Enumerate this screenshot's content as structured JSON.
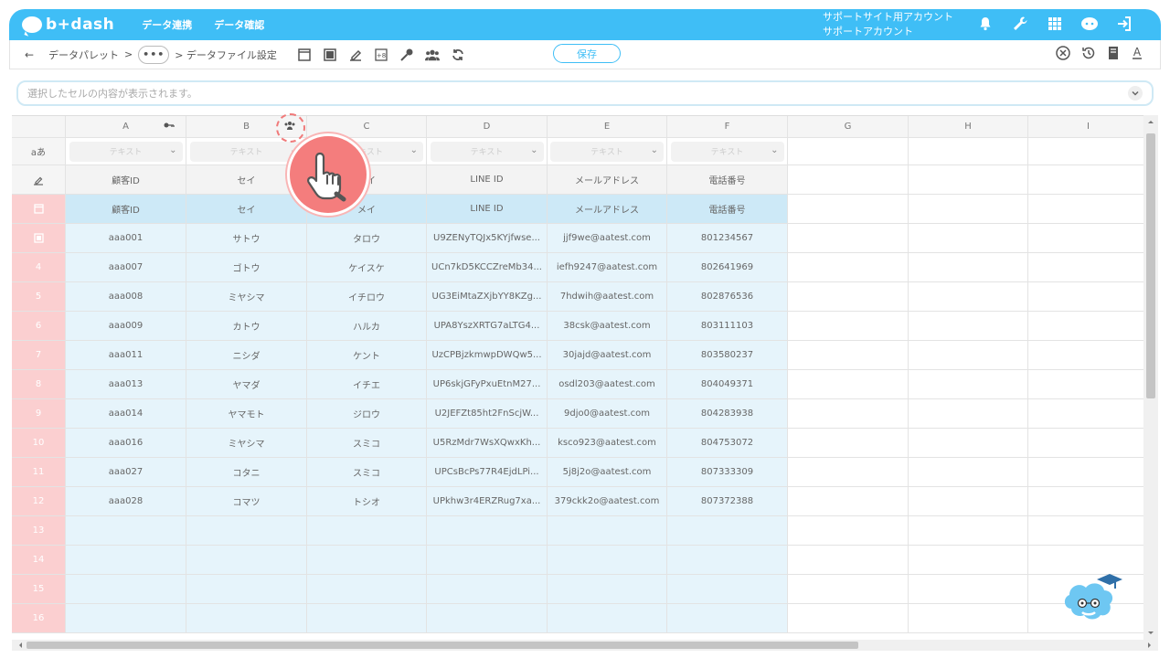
{
  "app": {
    "logo_text": "b+dash"
  },
  "nav": {
    "items": [
      "データ連携",
      "データ確認"
    ]
  },
  "account": {
    "line1": "サポートサイト用アカウント",
    "line2": "サポートアカウント"
  },
  "breadcrumb": {
    "back": "←",
    "parent": "データパレット",
    "sep": ">",
    "ellipsis": "•••",
    "current": "> データファイル設定"
  },
  "toolbar": {
    "save_label": "保存"
  },
  "cellbar": {
    "placeholder": "選択したセルの内容が表示されます。"
  },
  "grid": {
    "columns": [
      "A",
      "B",
      "C",
      "D",
      "E",
      "F",
      "G",
      "H",
      "I"
    ],
    "type_label": "テキスト",
    "type_row_head": "aあ",
    "header_labels": [
      "顧客ID",
      "セイ",
      "メイ",
      "LINE ID",
      "メールアドレス",
      "電話番号"
    ],
    "rows": [
      {
        "num": "4",
        "cells": [
          "aaa007",
          "ゴトウ",
          "ケイスケ",
          "UCn7kD5KCCZreMb34...",
          "iefh9247@aatest.com",
          "802641969"
        ]
      },
      {
        "num": "5",
        "cells": [
          "aaa008",
          "ミヤシマ",
          "イチロウ",
          "UG3EiMtaZXjbYY8KZg...",
          "7hdwih@aatest.com",
          "802876536"
        ]
      },
      {
        "num": "6",
        "cells": [
          "aaa009",
          "カトウ",
          "ハルカ",
          "UPA8YszXRTG7aLTG4...",
          "38csk@aatest.com",
          "803111103"
        ]
      },
      {
        "num": "7",
        "cells": [
          "aaa011",
          "ニシダ",
          "ケント",
          "UzCPBjzkmwpDWQw5...",
          "30jajd@aatest.com",
          "803580237"
        ]
      },
      {
        "num": "8",
        "cells": [
          "aaa013",
          "ヤマダ",
          "イチエ",
          "UP6skjGFyPxuEtnM27...",
          "osdl203@aatest.com",
          "804049371"
        ]
      },
      {
        "num": "9",
        "cells": [
          "aaa014",
          "ヤマモト",
          "ジロウ",
          "U2JEFZt85ht2FnScjW...",
          "9djo0@aatest.com",
          "804283938"
        ]
      },
      {
        "num": "10",
        "cells": [
          "aaa016",
          "ミヤシマ",
          "スミコ",
          "U5RzMdr7WsXQwxKh...",
          "ksco923@aatest.com",
          "804753072"
        ]
      },
      {
        "num": "11",
        "cells": [
          "aaa027",
          "コタニ",
          "スミコ",
          "UPCsBcPs77R4EjdLPi...",
          "5j8j2o@aatest.com",
          "807333309"
        ]
      },
      {
        "num": "12",
        "cells": [
          "aaa028",
          "コマツ",
          "トシオ",
          "UPkhw3r4ERZRug7xa...",
          "379ckk2o@aatest.com",
          "807372388"
        ]
      }
    ],
    "first_row": {
      "cells": [
        "aaa001",
        "サトウ",
        "タロウ",
        "U9ZENyTQJx5KYjfwse...",
        "jjf9we@aatest.com",
        "801234567"
      ]
    },
    "empty_rows": [
      "13",
      "14",
      "15",
      "16"
    ]
  },
  "colors": {
    "brand": "#3fbef6",
    "row_head": "#fbcfd0",
    "data_bg": "#e6f4fb",
    "pointer": "#f47d7d"
  }
}
